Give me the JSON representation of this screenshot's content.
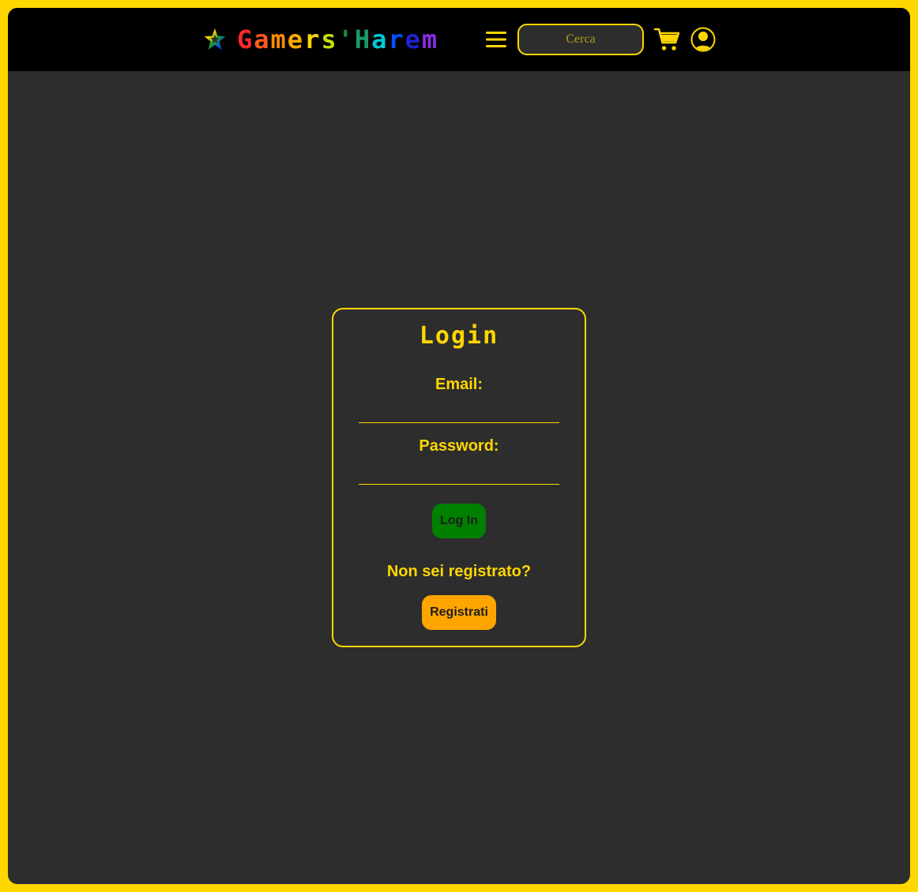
{
  "header": {
    "logo": {
      "icon": "rainbow-star-icon",
      "text_parts": [
        "G",
        "a",
        "m",
        "e",
        "r",
        "s",
        "'",
        "H",
        "a",
        "r",
        "e",
        "m"
      ],
      "colors": [
        "#FF2A2A",
        "#FF5A1A",
        "#FF8C00",
        "#FFA800",
        "#FFD700",
        "#C8E000",
        "#1A8F3A",
        "#1A9A6A",
        "#00C8D8",
        "#0050FF",
        "#2020D0",
        "#8A2BE2"
      ]
    },
    "menu_icon": "hamburger-menu-icon",
    "search_placeholder": "Cerca",
    "cart_icon": "shopping-cart-icon",
    "user_icon": "user-account-icon"
  },
  "login": {
    "title": "Login",
    "email_label": "Email:",
    "email_value": "",
    "password_label": "Password:",
    "password_value": "",
    "login_button": "Log In",
    "not_registered_text": "Non sei registrato?",
    "register_button": "Registrati"
  },
  "colors": {
    "accent": "#FFD700",
    "background": "#2D2D2D",
    "header": "#000000",
    "login_button": "#008000",
    "register_button": "#FFA500"
  }
}
